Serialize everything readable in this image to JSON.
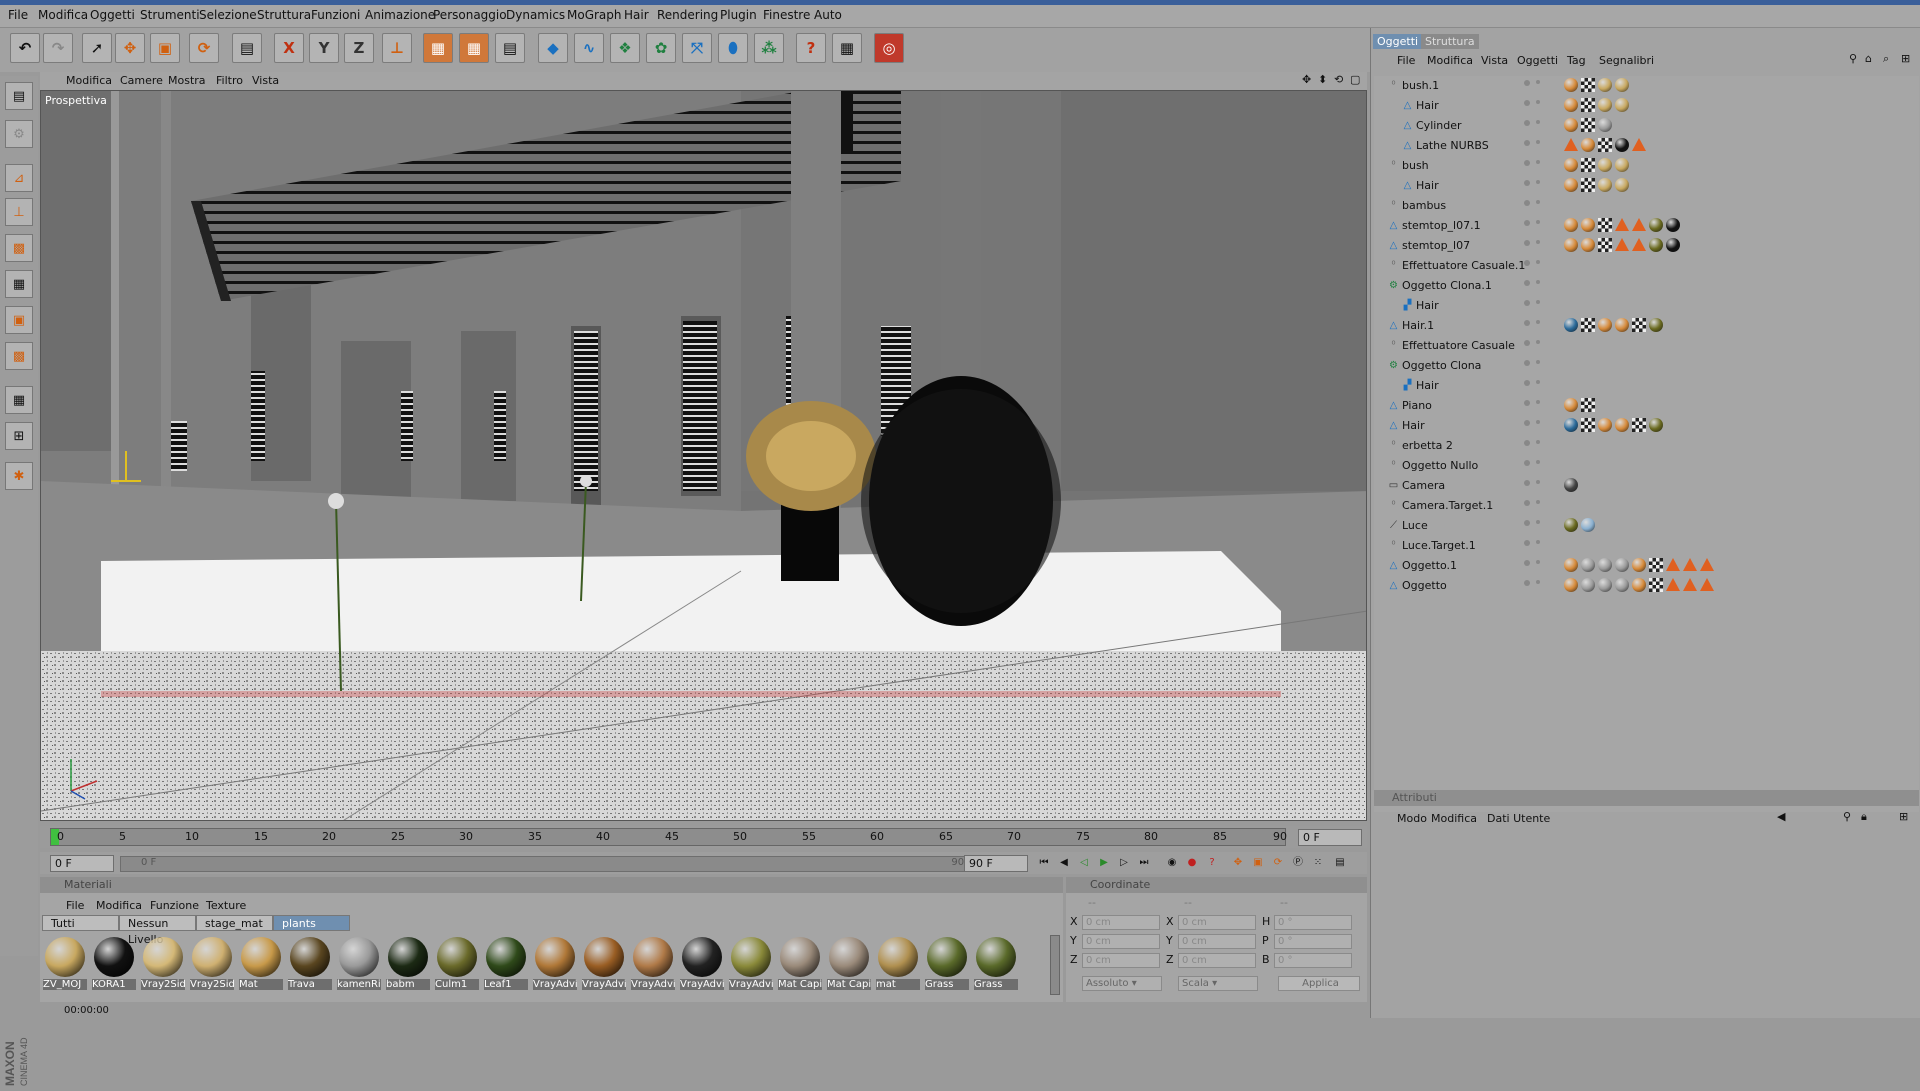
{
  "menu": [
    "File",
    "Modifica",
    "Oggetti",
    "Strumenti",
    "Selezione",
    "Struttura",
    "Funzioni",
    "Animazione",
    "Personaggio",
    "Dynamics",
    "MoGraph",
    "Hair",
    "Rendering",
    "Plugin",
    "Finestre",
    "Auto"
  ],
  "viewport": {
    "menu": [
      "Modifica",
      "Camere",
      "Mostra",
      "Filtro",
      "Vista"
    ],
    "label": "Prospettiva"
  },
  "timeline": {
    "ticks": [
      "0",
      "5",
      "10",
      "15",
      "20",
      "25",
      "30",
      "35",
      "40",
      "45",
      "50",
      "55",
      "60",
      "65",
      "70",
      "75",
      "80",
      "85",
      "90"
    ],
    "current_frame": "0 F",
    "start_frame": "0 F",
    "slider_left": "0 F",
    "slider_right": "90 F",
    "end_frame": "90 F"
  },
  "materials": {
    "header": "Materiali",
    "menu": [
      "File",
      "Modifica",
      "Funzione",
      "Texture"
    ],
    "tabs": [
      "Tutti",
      "Nessun Livello",
      "stage_mat",
      "plants"
    ],
    "items": [
      {
        "name": "ZV_MOJ",
        "color": "#c8a860"
      },
      {
        "name": "KORA1",
        "color": "#111111"
      },
      {
        "name": "Vray2Sid",
        "color": "#d4b877"
      },
      {
        "name": "Vray2Sid",
        "color": "#cfb071"
      },
      {
        "name": "Mat",
        "color": "#c89a4a"
      },
      {
        "name": "Trava",
        "color": "#5a4620"
      },
      {
        "name": "kamenRi",
        "color": "#9a9a9a"
      },
      {
        "name": "babm",
        "color": "#1c2a14"
      },
      {
        "name": "Culm1",
        "color": "#6a6a2a"
      },
      {
        "name": "Leaf1",
        "color": "#2f4a1a"
      },
      {
        "name": "VrayAdvi",
        "color": "#b07838"
      },
      {
        "name": "VrayAdvi",
        "color": "#9a5e24"
      },
      {
        "name": "VrayAdvi",
        "color": "#b07a48"
      },
      {
        "name": "VrayAdvi",
        "color": "#222222"
      },
      {
        "name": "VrayAdvi",
        "color": "#8a8a3a"
      },
      {
        "name": "Mat Capi",
        "color": "#9a8a7a"
      },
      {
        "name": "Mat Capi",
        "color": "#9a8a7a"
      },
      {
        "name": "mat",
        "color": "#b09050"
      },
      {
        "name": "Grass",
        "color": "#5a6a2a"
      },
      {
        "name": "Grass",
        "color": "#5a6a2a"
      }
    ]
  },
  "coords": {
    "header": "Coordinate",
    "dashes": [
      "--",
      "--",
      "--"
    ],
    "col1": [
      "X",
      "Y",
      "Z"
    ],
    "col2": [
      "X",
      "Y",
      "Z"
    ],
    "col3": [
      "H",
      "P",
      "B"
    ],
    "pos_values": [
      "0 cm",
      "0 cm",
      "0 cm"
    ],
    "size_values": [
      "0 cm",
      "0 cm",
      "0 cm"
    ],
    "rot_values": [
      "0 °",
      "0 °",
      "0 °"
    ],
    "mode1": "Assoluto",
    "mode2": "Scala",
    "apply": "Applica"
  },
  "status": {
    "time": "00:00:00"
  },
  "objects_panel": {
    "tabs": [
      "Oggetti",
      "Struttura"
    ],
    "menu": [
      "File",
      "Modifica",
      "Vista",
      "Oggetti",
      "Tag",
      "Segnalibri"
    ],
    "rows": [
      {
        "name": "bush.1",
        "indent": 0,
        "icon": "null",
        "tags": [
          "orange",
          "chk",
          "ball",
          "ball"
        ]
      },
      {
        "name": "Hair",
        "indent": 1,
        "icon": "tri",
        "tags": [
          "orange",
          "chk",
          "ball",
          "ball"
        ]
      },
      {
        "name": "Cylinder",
        "indent": 1,
        "icon": "tri",
        "tags": [
          "orange",
          "chk",
          "ball-grey"
        ]
      },
      {
        "name": "Lathe NURBS",
        "indent": 1,
        "icon": "tri",
        "tags": [
          "tri",
          "orange",
          "chk",
          "ball-black",
          "tri"
        ]
      },
      {
        "name": "bush",
        "indent": 0,
        "icon": "null",
        "tags": [
          "orange",
          "chk",
          "ball",
          "ball"
        ]
      },
      {
        "name": "Hair",
        "indent": 1,
        "icon": "tri",
        "tags": [
          "orange",
          "chk",
          "ball",
          "ball"
        ]
      },
      {
        "name": "bambus",
        "indent": 0,
        "icon": "null",
        "tags": []
      },
      {
        "name": "stemtop_l07.1",
        "indent": 0,
        "icon": "tri",
        "tags": [
          "orange",
          "orange",
          "chk",
          "tri",
          "tri",
          "ball-green",
          "ball-black"
        ]
      },
      {
        "name": "stemtop_l07",
        "indent": 0,
        "icon": "tri",
        "tags": [
          "orange",
          "orange",
          "chk",
          "tri",
          "tri",
          "ball-green",
          "ball-black"
        ]
      },
      {
        "name": "Effettuatore Casuale.1",
        "indent": 0,
        "icon": "null",
        "tags": []
      },
      {
        "name": "Oggetto Clona.1",
        "indent": 0,
        "icon": "gear",
        "tags": []
      },
      {
        "name": "Hair",
        "indent": 1,
        "icon": "hair",
        "tags": []
      },
      {
        "name": "Hair.1",
        "indent": 0,
        "icon": "tri",
        "tags": [
          "hair",
          "chk",
          "orange",
          "orange",
          "chk",
          "ball-green"
        ]
      },
      {
        "name": "Effettuatore Casuale",
        "indent": 0,
        "icon": "null",
        "tags": []
      },
      {
        "name": "Oggetto Clona",
        "indent": 0,
        "icon": "gear",
        "tags": []
      },
      {
        "name": "Hair",
        "indent": 1,
        "icon": "hair",
        "tags": []
      },
      {
        "name": "Piano",
        "indent": 0,
        "icon": "tri",
        "tags": [
          "orange",
          "chk"
        ]
      },
      {
        "name": "Hair",
        "indent": 0,
        "icon": "tri",
        "tags": [
          "hair",
          "chk",
          "orange",
          "orange",
          "chk",
          "ball-green"
        ]
      },
      {
        "name": "erbetta 2",
        "indent": 0,
        "icon": "null",
        "tags": []
      },
      {
        "name": "Oggetto Nullo",
        "indent": 0,
        "icon": "null",
        "tags": []
      },
      {
        "name": "Camera",
        "indent": 0,
        "icon": "cam",
        "tags": [
          "cam"
        ]
      },
      {
        "name": "Camera.Target.1",
        "indent": 0,
        "icon": "null",
        "tags": []
      },
      {
        "name": "Luce",
        "indent": 0,
        "icon": "light",
        "tags": [
          "ball-green",
          "star"
        ]
      },
      {
        "name": "Luce.Target.1",
        "indent": 0,
        "icon": "null",
        "tags": []
      },
      {
        "name": "Oggetto.1",
        "indent": 0,
        "icon": "tri",
        "tags": [
          "orange",
          "ball-grey",
          "ball-grey",
          "ball-grey",
          "orange",
          "chk",
          "tri",
          "tri",
          "tri"
        ]
      },
      {
        "name": "Oggetto",
        "indent": 0,
        "icon": "tri",
        "tags": [
          "orange",
          "ball-grey",
          "ball-grey",
          "ball-grey",
          "orange",
          "chk",
          "tri",
          "tri",
          "tri"
        ]
      }
    ]
  },
  "attributes_panel": {
    "header": "Attributi",
    "menu": [
      "Modo",
      "Modifica",
      "Dati Utente"
    ]
  },
  "colors": {
    "accent": "#d0783a",
    "panel": "#a3a3a3",
    "viewport": "#747474",
    "active_tab": "#6f8fb0"
  }
}
